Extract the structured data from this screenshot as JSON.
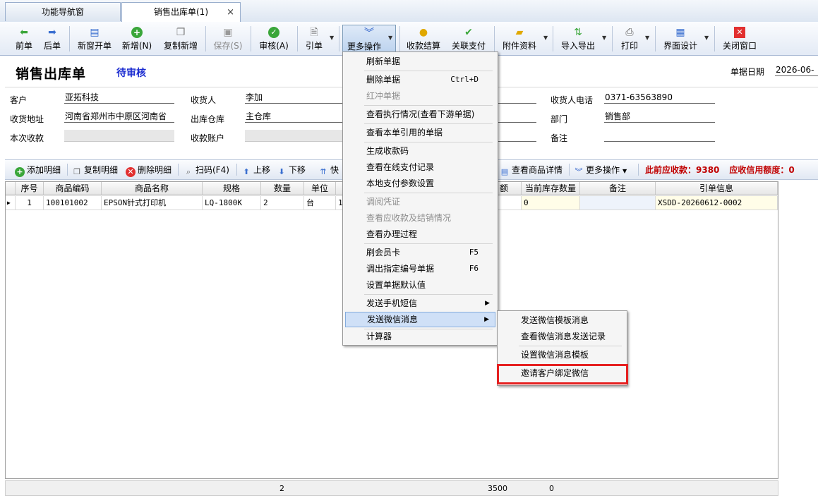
{
  "tabs": [
    {
      "label": "功能导航窗"
    },
    {
      "label": "销售出库单(1)",
      "close": "×"
    }
  ],
  "toolbar": {
    "prev": "前单",
    "next": "后单",
    "new_window": "新窗开单",
    "add": "新增(N)",
    "copy_add": "复制新增",
    "save": "保存(S)",
    "audit": "审核(A)",
    "import": "引单",
    "more": "更多操作",
    "receipt": "收款结算",
    "linked_pay": "关联支付",
    "attachments": "附件资料",
    "import_export": "导入导出",
    "print": "打印",
    "ui_design": "界面设计",
    "close_window": "关闭窗口"
  },
  "header": {
    "title": "销售出库单",
    "status": "待审核",
    "date_label": "单据日期",
    "date_value": "2026-06-"
  },
  "form": {
    "customer_label": "客户",
    "customer": "亚拓科技",
    "consignee_label": "收货人",
    "consignee": "李加",
    "consignee_phone_label": "收货人电话",
    "consignee_phone": "0371-63563890",
    "address_label": "收货地址",
    "address": "河南省郑州市中原区河南省",
    "warehouse_label": "出库仓库",
    "warehouse": "主仓库",
    "dept_label": "部门",
    "dept": "销售部",
    "payment_label": "本次收款",
    "payment": "",
    "account_label": "收款账户",
    "account": "",
    "remark_label": "备注",
    "remark": ""
  },
  "detail_toolbar": {
    "add": "添加明细",
    "copy": "复制明细",
    "delete": "删除明细",
    "scan": "扫码(F4)",
    "up": "上移",
    "down": "下移",
    "quick": "快",
    "view_product": "查看商品详情",
    "more": "更多操作",
    "ar_label": "此前应收款：9380",
    "credit_label": "应收信用额度：0"
  },
  "grid": {
    "headers": [
      "序号",
      "商品编码",
      "商品名称",
      "规格",
      "数量",
      "单位",
      "额",
      "当前库存数量",
      "备注",
      "引单信息"
    ],
    "rows": [
      [
        "1",
        "100101002",
        "EPSON针式打印机",
        "LQ-1800K",
        "2",
        "台",
        "1",
        "0",
        "",
        "XSDD-20260612-0002"
      ]
    ],
    "footer": {
      "qty": "2",
      "amount": "3500",
      "stock": "0"
    }
  },
  "menu": {
    "items": [
      {
        "label": "刷新单据"
      },
      {
        "label": "删除单据",
        "shortcut": "Ctrl+D"
      },
      {
        "label": "红冲单据",
        "disabled": true
      },
      {
        "label": "查看执行情况(查看下游单据)"
      },
      {
        "label": "查看本单引用的单据"
      },
      {
        "label": "生成收款码"
      },
      {
        "label": "查看在线支付记录"
      },
      {
        "label": "本地支付参数设置"
      },
      {
        "label": "调阅凭证",
        "disabled": true
      },
      {
        "label": "查看应收款及结销情况",
        "disabled": true
      },
      {
        "label": "查看办理过程"
      },
      {
        "label": "刷会员卡",
        "shortcut": "F5"
      },
      {
        "label": "调出指定编号单据",
        "shortcut": "F6"
      },
      {
        "label": "设置单据默认值"
      },
      {
        "label": "发送手机短信"
      },
      {
        "label": "发送微信消息"
      },
      {
        "label": "计算器"
      }
    ],
    "submenu": [
      {
        "label": "发送微信模板消息"
      },
      {
        "label": "查看微信消息发送记录"
      },
      {
        "label": "设置微信消息模板"
      },
      {
        "label": "邀请客户绑定微信"
      }
    ]
  },
  "colors": {
    "accent_blue": "#1a2bd0",
    "alert_red": "#c00000",
    "highlight_box": "#e52020"
  }
}
